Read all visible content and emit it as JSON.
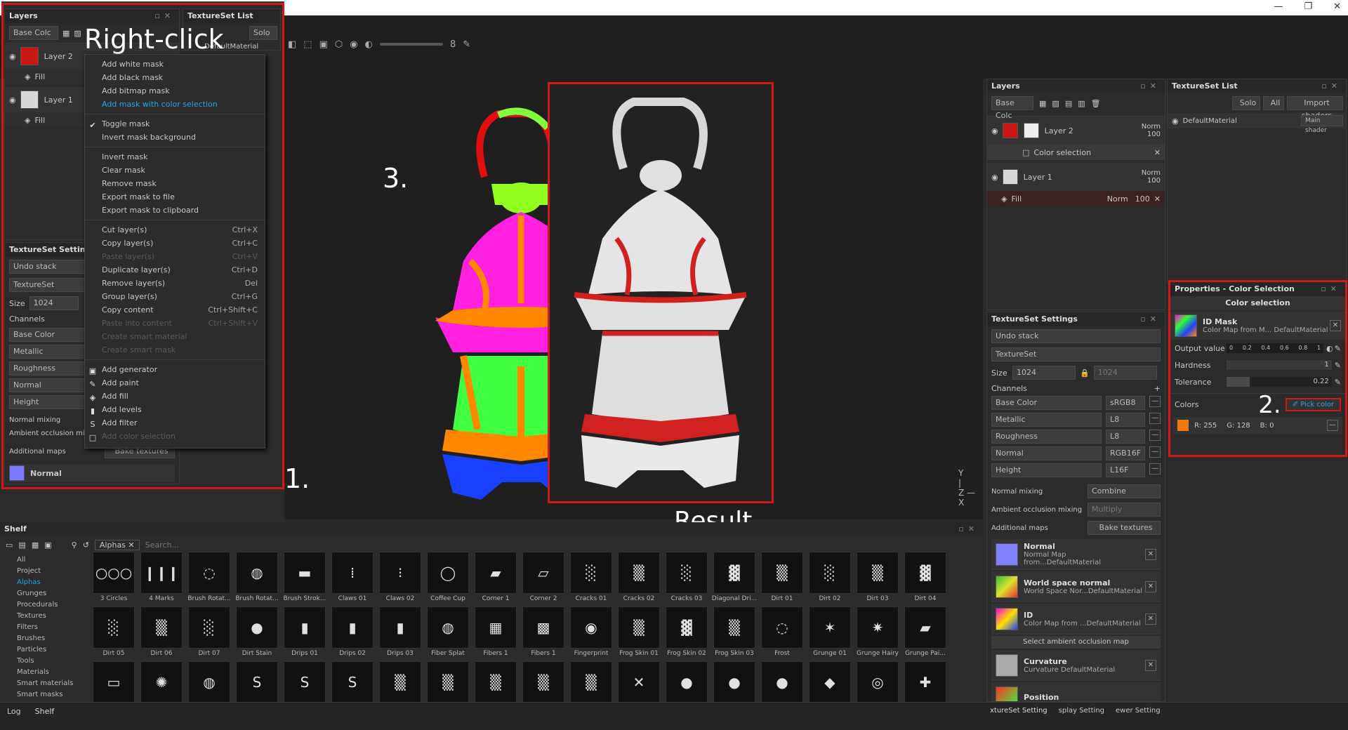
{
  "window": {
    "minimize": "—",
    "maximize": "❐",
    "close": "✕"
  },
  "annotations": {
    "right_click": "Right-click",
    "step1": "1.",
    "step2": "2.",
    "step3": "3.",
    "result": "Result"
  },
  "layers_left": {
    "title": "Layers",
    "channel": "Base Colc",
    "layers": [
      {
        "name": "Layer 2",
        "sub": "Fill",
        "color": "#cc1515"
      },
      {
        "name": "Layer 1",
        "sub": "Fill",
        "color": "#d8d8d8"
      }
    ]
  },
  "textureset_list_left": {
    "title": "TextureSet List",
    "solo": "Solo",
    "material": "DefaultMaterial"
  },
  "context_menu": {
    "group1": [
      "Add white mask",
      "Add black mask",
      "Add bitmap mask",
      "Add mask with color selection"
    ],
    "group2": [
      "Toggle mask",
      "Invert mask background"
    ],
    "group3": [
      "Invert mask",
      "Clear mask",
      "Remove mask",
      "Export mask to file",
      "Export mask to clipboard"
    ],
    "group4": [
      {
        "label": "Cut layer(s)",
        "shortcut": "Ctrl+X"
      },
      {
        "label": "Copy layer(s)",
        "shortcut": "Ctrl+C"
      },
      {
        "label": "Paste layer(s)",
        "shortcut": "Ctrl+V"
      },
      {
        "label": "Duplicate layer(s)",
        "shortcut": "Ctrl+D"
      },
      {
        "label": "Remove layer(s)",
        "shortcut": "Del"
      },
      {
        "label": "Group layer(s)",
        "shortcut": "Ctrl+G"
      },
      {
        "label": "Copy content",
        "shortcut": "Ctrl+Shift+C"
      },
      {
        "label": "Paste into content",
        "shortcut": "Ctrl+Shift+V"
      },
      {
        "label": "Create smart material",
        "shortcut": ""
      },
      {
        "label": "Create smart mask",
        "shortcut": ""
      }
    ],
    "group5": [
      "Add generator",
      "Add paint",
      "Add fill",
      "Add levels",
      "Add filter",
      "Add color selection"
    ]
  },
  "textureset_settings_left": {
    "title": "TextureSet Setting",
    "undo": "Undo stack",
    "textureset": "TextureSet",
    "size_label": "Size",
    "size_value": "1024",
    "channels": "Channels",
    "list": [
      "Base Color",
      "Metallic",
      "Roughness",
      "Normal",
      "Height"
    ],
    "normal_mixing": "Normal mixing",
    "ao_mixing": "Ambient occlusion mix",
    "additional_maps": "Additional maps",
    "bake": "Bake textures",
    "normal_map": "Normal"
  },
  "layers_right": {
    "title": "Layers",
    "channel": "Base Colc",
    "layer2": {
      "name": "Layer 2",
      "blend": "Norm",
      "opacity": "100",
      "mask": "Color selection"
    },
    "layer1": {
      "name": "Layer 1",
      "blend": "Norm",
      "opacity": "100",
      "fill": "Fill",
      "fill_blend": "Norm",
      "fill_opacity": "100"
    }
  },
  "textureset_list_right": {
    "title": "TextureSet List",
    "solo": "Solo",
    "all": "All",
    "import": "Import shaders",
    "material": "DefaultMaterial",
    "shader": "Main shader"
  },
  "properties": {
    "title": "Properties - Color Selection",
    "section": "Color selection",
    "id_mask": "ID Mask",
    "id_sub": "Color Map from M... DefaultMaterial",
    "output_label": "Output value",
    "output_ticks": [
      "0",
      "0.2",
      "0.4",
      "0.6",
      "0.8",
      "1"
    ],
    "hardness_label": "Hardness",
    "hardness_value": "1",
    "tolerance_label": "Tolerance",
    "tolerance_value": "0.22",
    "colors_label": "Colors",
    "pick_color": "Pick color",
    "color_rgb": {
      "r": "R: 255",
      "g": "G: 128",
      "b": "B: 0"
    },
    "swatch": "#f07a10"
  },
  "textureset_settings_right": {
    "title": "TextureSet Settings",
    "undo": "Undo stack",
    "textureset": "TextureSet",
    "size_label": "Size",
    "size_value": "1024",
    "size_value2": "1024",
    "channels": "Channels",
    "rows": [
      {
        "name": "Base Color",
        "fmt": "sRGB8"
      },
      {
        "name": "Metallic",
        "fmt": "L8"
      },
      {
        "name": "Roughness",
        "fmt": "L8"
      },
      {
        "name": "Normal",
        "fmt": "RGB16F"
      },
      {
        "name": "Height",
        "fmt": "L16F"
      }
    ],
    "normal_mixing": "Normal mixing",
    "normal_mixing_value": "Combine",
    "ao_mixing": "Ambient occlusion mixing",
    "ao_value": "Multiply",
    "additional_maps": "Additional maps",
    "bake": "Bake textures",
    "maps": [
      {
        "name": "Normal",
        "sub": "Normal Map from...DefaultMaterial"
      },
      {
        "name": "World space normal",
        "sub": "World Space Nor...DefaultMaterial"
      },
      {
        "name": "ID",
        "sub": "Color Map from ...DefaultMaterial"
      }
    ],
    "select_ao": "Select ambient occlusion map",
    "maps2": [
      {
        "name": "Curvature",
        "sub": "Curvature DefaultMaterial"
      },
      {
        "name": "Position",
        "sub": ""
      }
    ]
  },
  "shelf": {
    "title": "Shelf",
    "filter_tag": "Alphas",
    "search": "Search...",
    "categories": [
      "All",
      "Project",
      "Alphas",
      "Grunges",
      "Procedurals",
      "Textures",
      "Filters",
      "Brushes",
      "Particles",
      "Tools",
      "Materials",
      "Smart materials",
      "Smart masks"
    ],
    "items": [
      "3 Circles",
      "4 Marks",
      "Brush Rotat...",
      "Brush Rotat...",
      "Brush Strok...",
      "Claws 01",
      "Claws 02",
      "Coffee Cup",
      "Corner 1",
      "Corner 2",
      "Cracks 01",
      "Cracks 02",
      "Cracks 03",
      "Diagonal Dri...",
      "Dirt 01",
      "Dirt 02",
      "Dirt 03",
      "Dirt 04",
      "Dirt 05",
      "Dirt 06",
      "Dirt 07",
      "Dirt Stain",
      "Drips 01",
      "Drips 02",
      "Drips 03",
      "Fiber Splat",
      "Fibers 1",
      "Fibers 1",
      "Fingerprint",
      "Frog Skin 01",
      "Frog Skin 02",
      "Frog Skin 03",
      "Frost",
      "Grunge 01",
      "Grunge Hairy",
      "Grunge Pai...",
      "",
      "",
      "",
      "",
      "",
      "",
      "",
      "",
      "",
      "",
      "",
      "",
      "",
      "",
      "",
      "",
      "",
      ""
    ]
  },
  "status": {
    "log": "Log",
    "shelf": "Shelf",
    "tabs": [
      "xtureSet Setting",
      "splay Setting",
      "ewer Setting"
    ]
  },
  "toolbar": {
    "value": "8"
  }
}
